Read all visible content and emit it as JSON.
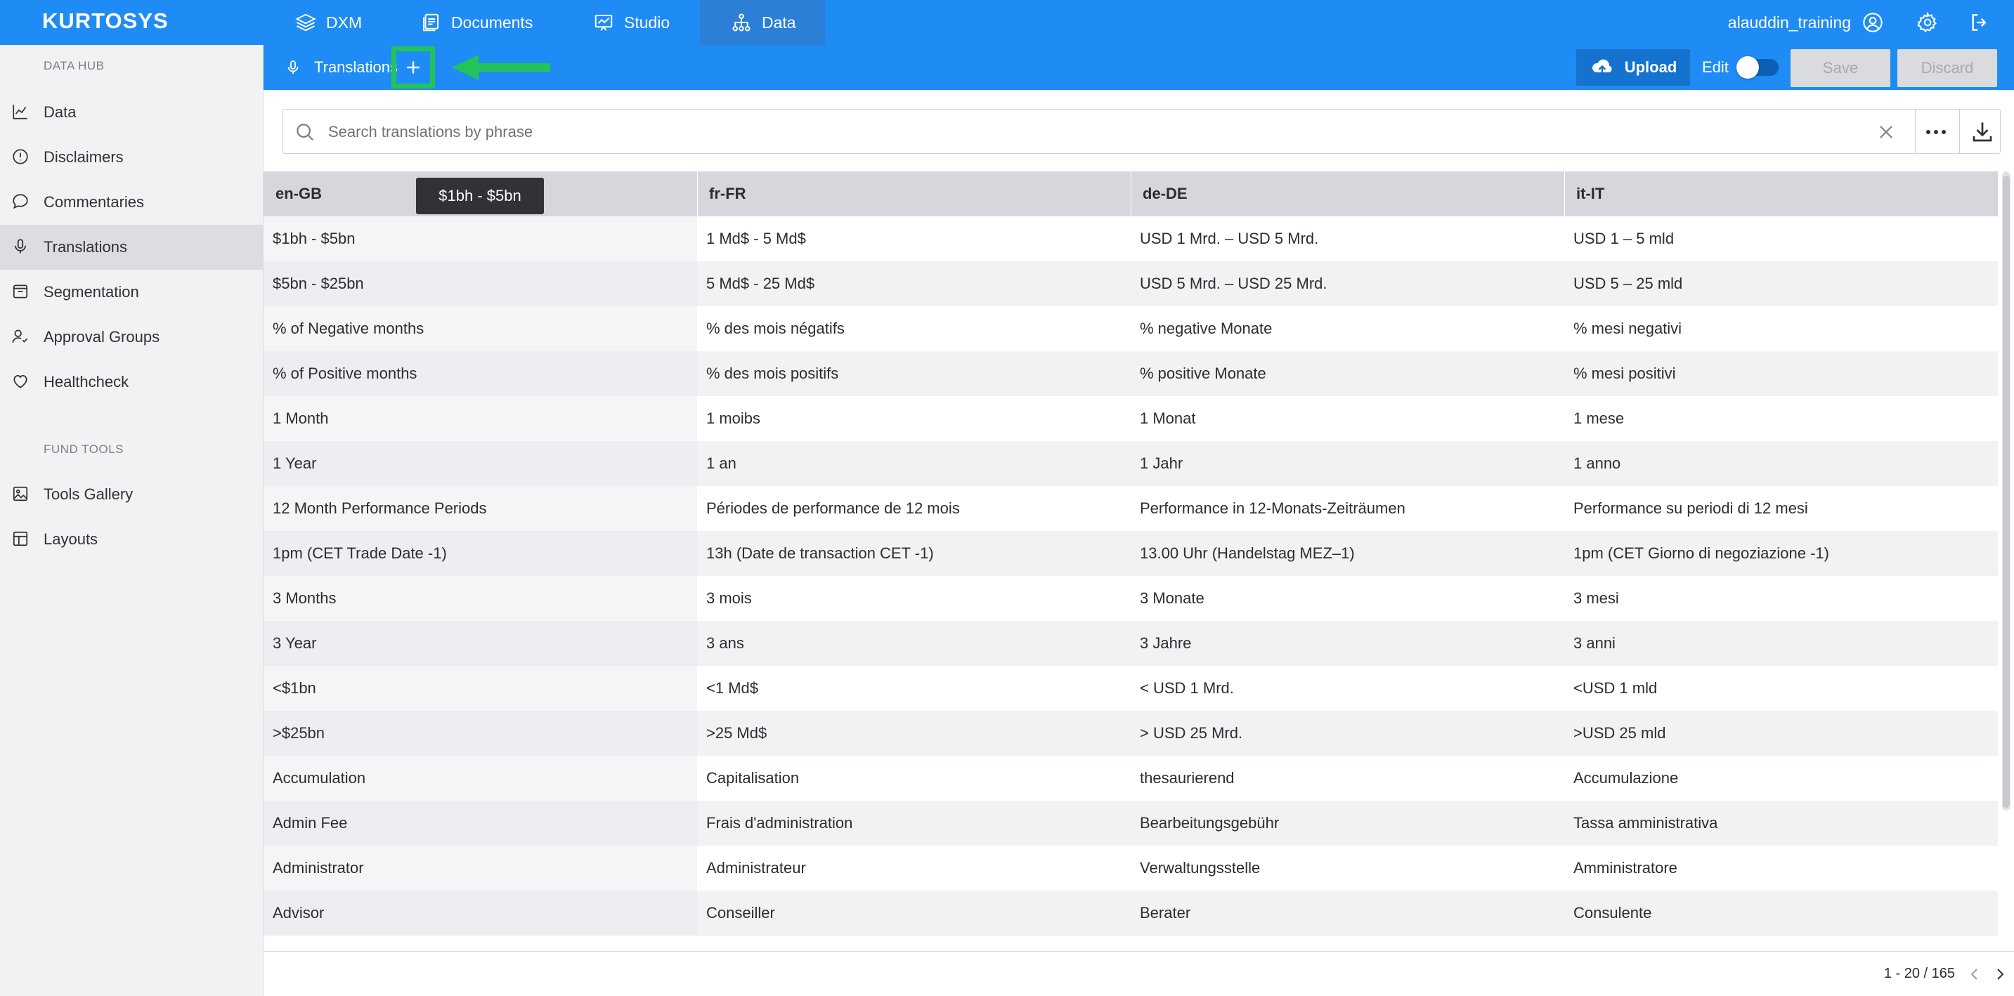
{
  "brand": {
    "logo": "KURTOSYS",
    "accent": "#1e8cf4",
    "highlight": "#23c35a"
  },
  "nav": {
    "tabs": [
      {
        "label": "DXM",
        "icon": "layers-icon"
      },
      {
        "label": "Documents",
        "icon": "documents-icon"
      },
      {
        "label": "Studio",
        "icon": "chart-board-icon"
      },
      {
        "label": "Data",
        "icon": "hierarchy-icon",
        "active": true
      }
    ],
    "username": "alauddin_training"
  },
  "sidebar": {
    "section1": "DATA HUB",
    "items": [
      {
        "label": "Data",
        "icon": "line-chart-icon"
      },
      {
        "label": "Disclaimers",
        "icon": "alert-circle-icon"
      },
      {
        "label": "Commentaries",
        "icon": "chat-bubble-icon"
      },
      {
        "label": "Translations",
        "icon": "microphone-icon",
        "active": true
      },
      {
        "label": "Segmentation",
        "icon": "box-icon"
      },
      {
        "label": "Approval Groups",
        "icon": "user-check-icon"
      },
      {
        "label": "Healthcheck",
        "icon": "heart-icon"
      }
    ],
    "section2": "FUND TOOLS",
    "items2": [
      {
        "label": "Tools Gallery",
        "icon": "image-gallery-icon"
      },
      {
        "label": "Layouts",
        "icon": "layout-icon"
      }
    ]
  },
  "subbar": {
    "title": "Translations",
    "upload": "Upload",
    "edit": "Edit",
    "edit_on": false,
    "save": "Save",
    "discard": "Discard"
  },
  "search": {
    "placeholder": "Search translations by phrase",
    "value": ""
  },
  "table": {
    "columns": [
      "en-GB",
      "fr-FR",
      "de-DE",
      "it-IT"
    ],
    "rows": [
      [
        "$1bh - $5bn",
        "1 Md$ - 5 Md$",
        "USD 1 Mrd. – USD 5 Mrd.",
        "USD 1 – 5 mld"
      ],
      [
        "$5bn - $25bn",
        "5 Md$ - 25 Md$",
        "USD 5 Mrd. – USD 25 Mrd.",
        "USD 5 – 25 mld"
      ],
      [
        "% of Negative months",
        "% des mois négatifs",
        "% negative Monate",
        "% mesi negativi"
      ],
      [
        "% of Positive months",
        "% des mois positifs",
        "% positive Monate",
        "% mesi positivi"
      ],
      [
        "1 Month",
        "1 moibs",
        "1 Monat",
        "1 mese"
      ],
      [
        "1 Year",
        "1 an",
        "1 Jahr",
        "1 anno"
      ],
      [
        "12 Month Performance Periods",
        "Périodes de performance de 12 mois",
        "Performance in 12-Monats-Zeiträumen",
        "Performance su periodi di 12 mesi"
      ],
      [
        "1pm (CET Trade Date -1)",
        "13h (Date de transaction CET -1)",
        "13.00 Uhr (Handelstag MEZ–1)",
        "1pm (CET Giorno di negoziazione -1)"
      ],
      [
        "3 Months",
        "3 mois",
        "3 Monate",
        "3 mesi"
      ],
      [
        "3 Year",
        "3 ans",
        "3 Jahre",
        "3 anni"
      ],
      [
        "<$1bn",
        "<1 Md$",
        "< USD 1 Mrd.",
        "<USD 1 mld"
      ],
      [
        ">$25bn",
        ">25 Md$",
        "> USD 25 Mrd.",
        ">USD 25 mld"
      ],
      [
        "Accumulation",
        "Capitalisation",
        "thesaurierend",
        "Accumulazione"
      ],
      [
        "Admin Fee",
        "Frais d'administration",
        "Bearbeitungsgebühr",
        "Tassa amministrativa"
      ],
      [
        "Administrator",
        "Administrateur",
        "Verwaltungsstelle",
        "Amministratore"
      ],
      [
        "Advisor",
        "Conseiller",
        "Berater",
        "Consulente"
      ]
    ]
  },
  "tooltip": "$1bh - $5bn",
  "pager": {
    "text": "1 - 20 / 165"
  }
}
